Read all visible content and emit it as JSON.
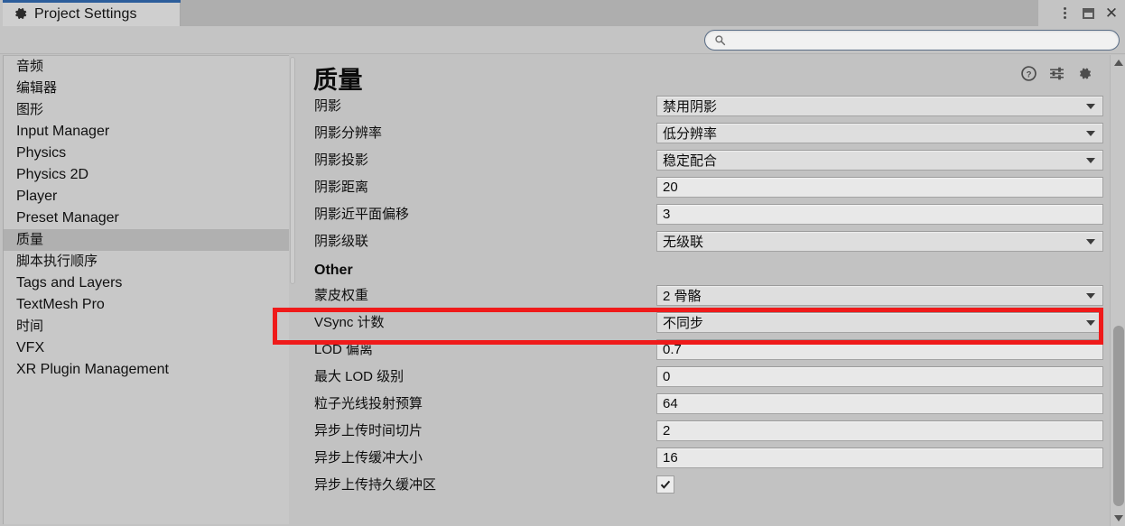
{
  "window": {
    "tab_label": "Project Settings",
    "tab_icon": "gear-icon",
    "accent_color": "#2c5d9b",
    "controls": {
      "menu": "kebab-menu-icon",
      "restore": "restore-window-icon",
      "close": "close-icon"
    }
  },
  "search": {
    "value": "",
    "placeholder": "",
    "icon": "search-icon"
  },
  "sidebar": {
    "items": [
      {
        "label": "音频",
        "cjk": true,
        "selected": false
      },
      {
        "label": "编辑器",
        "cjk": true,
        "selected": false
      },
      {
        "label": "图形",
        "cjk": true,
        "selected": false
      },
      {
        "label": "Input Manager",
        "cjk": false,
        "selected": false
      },
      {
        "label": "Physics",
        "cjk": false,
        "selected": false
      },
      {
        "label": "Physics 2D",
        "cjk": false,
        "selected": false
      },
      {
        "label": "Player",
        "cjk": false,
        "selected": false
      },
      {
        "label": "Preset Manager",
        "cjk": false,
        "selected": false
      },
      {
        "label": "质量",
        "cjk": true,
        "selected": true
      },
      {
        "label": "脚本执行顺序",
        "cjk": true,
        "selected": false
      },
      {
        "label": "Tags and Layers",
        "cjk": false,
        "selected": false
      },
      {
        "label": "TextMesh Pro",
        "cjk": false,
        "selected": false
      },
      {
        "label": "时间",
        "cjk": true,
        "selected": false
      },
      {
        "label": "VFX",
        "cjk": false,
        "selected": false
      },
      {
        "label": "XR Plugin Management",
        "cjk": false,
        "selected": false
      }
    ]
  },
  "content": {
    "title": "质量",
    "header_icons": [
      {
        "name": "help-icon"
      },
      {
        "name": "preset-icon"
      },
      {
        "name": "settings-gear-icon"
      }
    ],
    "rows": [
      {
        "kind": "popup",
        "label": "阴影",
        "value": "禁用阴影",
        "name": "shadows"
      },
      {
        "kind": "popup",
        "label": "阴影分辨率",
        "value": "低分辨率",
        "name": "shadow-resolution"
      },
      {
        "kind": "popup",
        "label": "阴影投影",
        "value": "稳定配合",
        "name": "shadow-projection"
      },
      {
        "kind": "number",
        "label": "阴影距离",
        "value": "20",
        "name": "shadow-distance"
      },
      {
        "kind": "number",
        "label": "阴影近平面偏移",
        "value": "3",
        "name": "shadow-near-plane-offset"
      },
      {
        "kind": "popup",
        "label": "阴影级联",
        "value": "无级联",
        "name": "shadow-cascades"
      },
      {
        "kind": "section",
        "label": "Other",
        "value": "",
        "name": "other-section"
      },
      {
        "kind": "popup",
        "label": "蒙皮权重",
        "value": "2 骨骼",
        "name": "skin-weights"
      },
      {
        "kind": "popup",
        "label": "VSync 计数",
        "value": "不同步",
        "name": "vsync-count",
        "highlighted": true
      },
      {
        "kind": "number",
        "label": "LOD 偏离",
        "value": "0.7",
        "name": "lod-bias"
      },
      {
        "kind": "number",
        "label": "最大 LOD 级别",
        "value": "0",
        "name": "maximum-lod-level"
      },
      {
        "kind": "number",
        "label": "粒子光线投射预算",
        "value": "64",
        "name": "particle-raycast-budget"
      },
      {
        "kind": "number",
        "label": "异步上传时间切片",
        "value": "2",
        "name": "async-upload-time-slice"
      },
      {
        "kind": "number",
        "label": "异步上传缓冲大小",
        "value": "16",
        "name": "async-upload-buffer-size"
      },
      {
        "kind": "checkbox",
        "label": "异步上传持久缓冲区",
        "value": "checked",
        "name": "async-upload-persistent-buffer"
      }
    ]
  },
  "annotation": {
    "color": "#ef1a1a",
    "target": "vsync-count-row"
  }
}
